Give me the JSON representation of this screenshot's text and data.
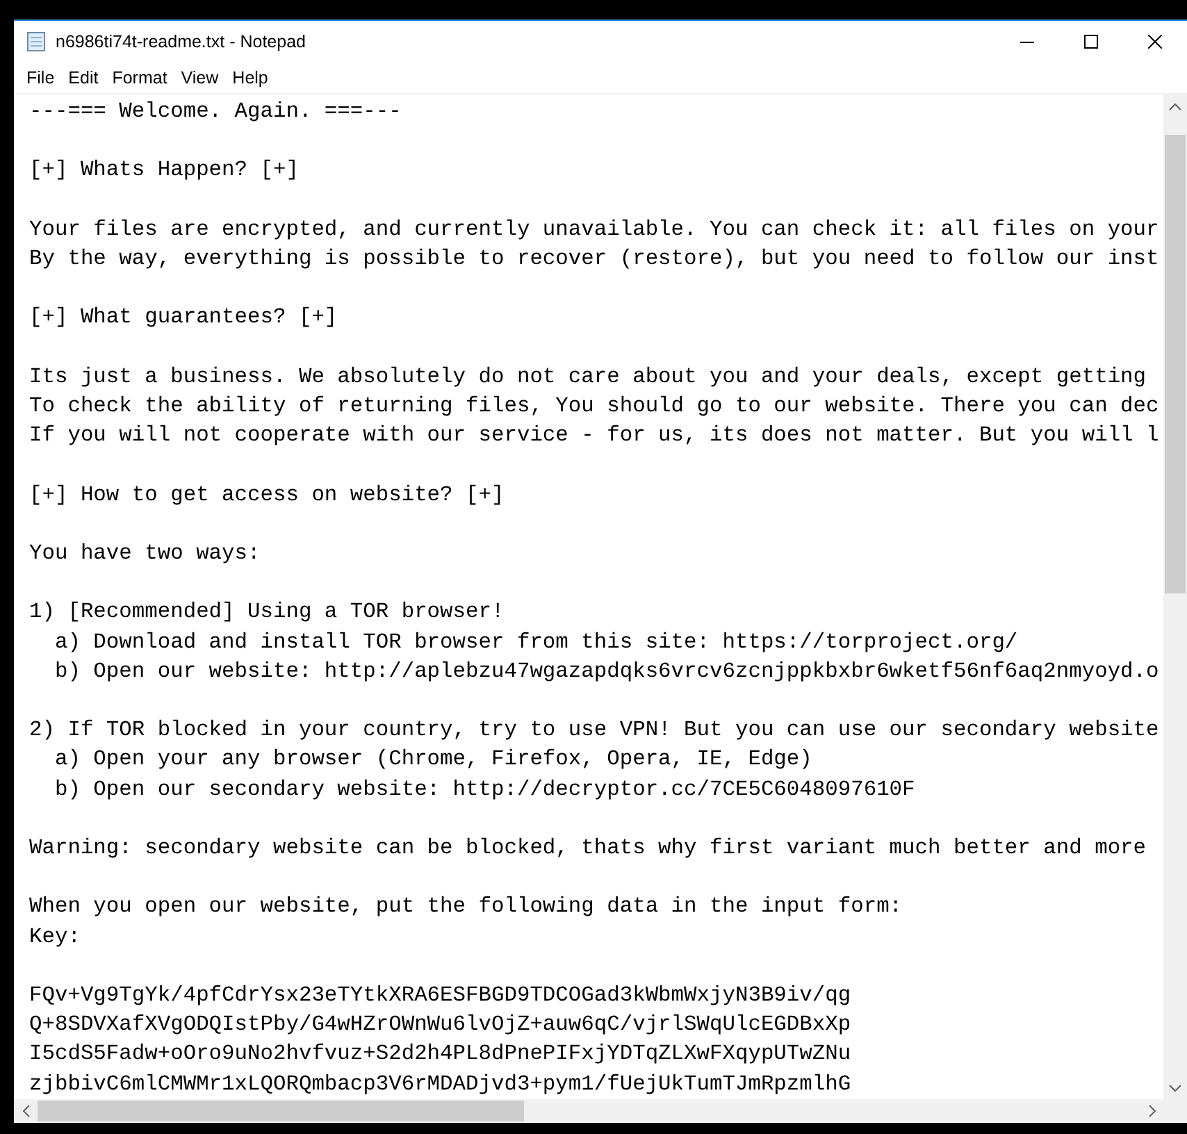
{
  "window": {
    "title": "n6986ti74t-readme.txt - Notepad"
  },
  "menu": [
    "File",
    "Edit",
    "Format",
    "View",
    "Help"
  ],
  "document": {
    "paragraphs": [
      [
        "---=== Welcome. Again. ===---"
      ],
      [
        "[+] Whats Happen? [+]"
      ],
      [
        "Your files are encrypted, and currently unavailable. You can check it: all files on your",
        "By the way, everything is possible to recover (restore), but you need to follow our inst"
      ],
      [
        "[+] What guarantees? [+]"
      ],
      [
        "Its just a business. We absolutely do not care about you and your deals, except getting",
        "To check the ability of returning files, You should go to our website. There you can dec",
        "If you will not cooperate with our service - for us, its does not matter. But you will l"
      ],
      [
        "[+] How to get access on website? [+]"
      ],
      [
        "You have two ways:"
      ],
      [
        "1) [Recommended] Using a TOR browser!",
        "  a) Download and install TOR browser from this site: https://torproject.org/",
        "  b) Open our website: http://aplebzu47wgazapdqks6vrcv6zcnjppkbxbr6wketf56nf6aq2nmyoyd.o"
      ],
      [
        "2) If TOR blocked in your country, try to use VPN! But you can use our secondary website",
        "  a) Open your any browser (Chrome, Firefox, Opera, IE, Edge)",
        "  b) Open our secondary website: http://decryptor.cc/7CE5C6048097610F"
      ],
      [
        "Warning: secondary website can be blocked, thats why first variant much better and more"
      ],
      [
        "When you open our website, put the following data in the input form:",
        "Key:"
      ],
      [
        "FQv+Vg9TgYk/4pfCdrYsx23eTYtkXRA6ESFBGD9TDCOGad3kWbmWxjyN3B9iv/qg",
        "Q+8SDVXafXVgODQIstPby/G4wHZrOWnWu6lvOjZ+auw6qC/vjrlSWqUlcEGDBxXp",
        "I5cdS5Fadw+oOro9uNo2hvfvuz+S2d2h4PL8dPnePIFxjYDTqZLXwFXqypUTwZNu",
        "zjbbivC6mlCMWMr1xLQORQmbacp3V6rMDADjvd3+pym1/fUejUkTumTJmRpzmlhG"
      ]
    ]
  }
}
